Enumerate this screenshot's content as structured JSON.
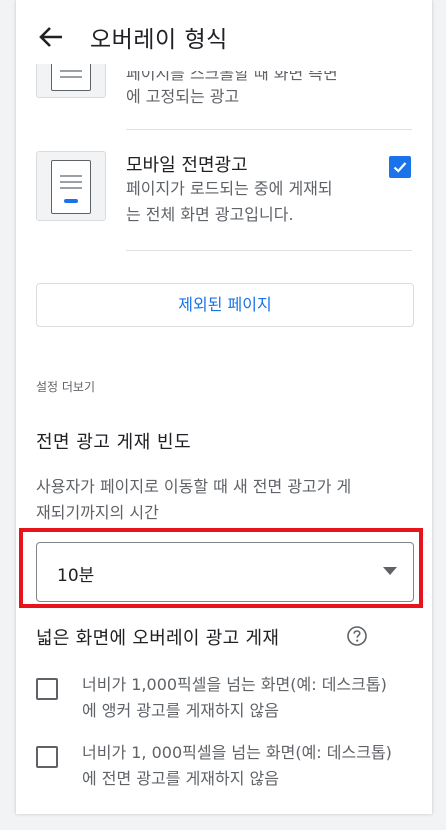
{
  "header": {
    "title": "오버레이 형식"
  },
  "top_ad": {
    "desc_partial_line1": "페이지를 스크롤할 때 화면 측면",
    "desc_partial_line2": "에 고정되는 광고"
  },
  "interstitial": {
    "title": "모바일 전면광고",
    "desc_line1": "페이지가 로드되는 중에 게재되",
    "desc_line2": "는 전체 화면 광고입니다.",
    "checked": true
  },
  "excluded_pages_button": "제외된 페이지",
  "more_settings_label": "설정 더보기",
  "frequency": {
    "title": "전면 광고 게재 빈도",
    "desc_line1": "사용자가 페이지로 이동할 때 새 전면 광고가 게",
    "desc_line2": "재되기까지의 시간",
    "selected_value": "10분"
  },
  "wide_screen": {
    "title": "넓은 화면에 오버레이 광고 게재",
    "option1_line1": "너비가 1,000픽셀을 넘는 화면(예: 데스크톱)",
    "option1_line2": "에 앵커 광고를 게재하지 않음",
    "option2_line1": "너비가 1, 000픽셀을 넘는 화면(예: 데스크톱)",
    "option2_line2": "에 전면 광고를 게재하지 않음"
  },
  "colors": {
    "accent": "#1a73e8",
    "highlight": "#e8141c"
  }
}
